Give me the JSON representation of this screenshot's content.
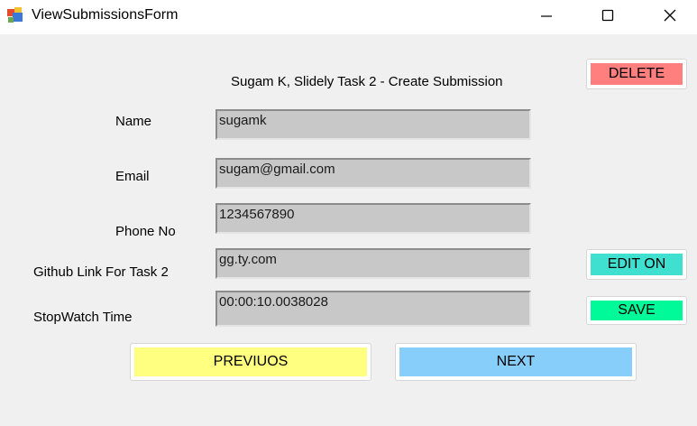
{
  "window": {
    "title": "ViewSubmissionsForm",
    "icon": "app-form-icon",
    "controls": [
      "minimize-icon",
      "maximize-icon",
      "close-icon"
    ]
  },
  "header": {
    "title": "Sugam K, Slidely Task 2 - Create Submission"
  },
  "form": {
    "name_label": "Name",
    "name_value": "sugamk",
    "email_label": "Email",
    "email_value": "sugam@gmail.com",
    "phone_label": "Phone No",
    "phone_value": "1234567890",
    "github_label": "Github Link For Task 2",
    "github_value": "gg.ty.com",
    "stopwatch_label": "StopWatch Time",
    "stopwatch_value": "00:00:10.0038028"
  },
  "buttons": {
    "delete": "DELETE",
    "edit": "EDIT ON",
    "save": "SAVE",
    "previous": "PREVIUOS",
    "next": "NEXT"
  },
  "colors": {
    "delete": "#ff7f7f",
    "edit": "#40e0d0",
    "save": "#00fa9a",
    "previous": "#ffff80",
    "next": "#87cefa",
    "field_bg": "#c8c8c8",
    "window_bg": "#f0f0f0"
  }
}
